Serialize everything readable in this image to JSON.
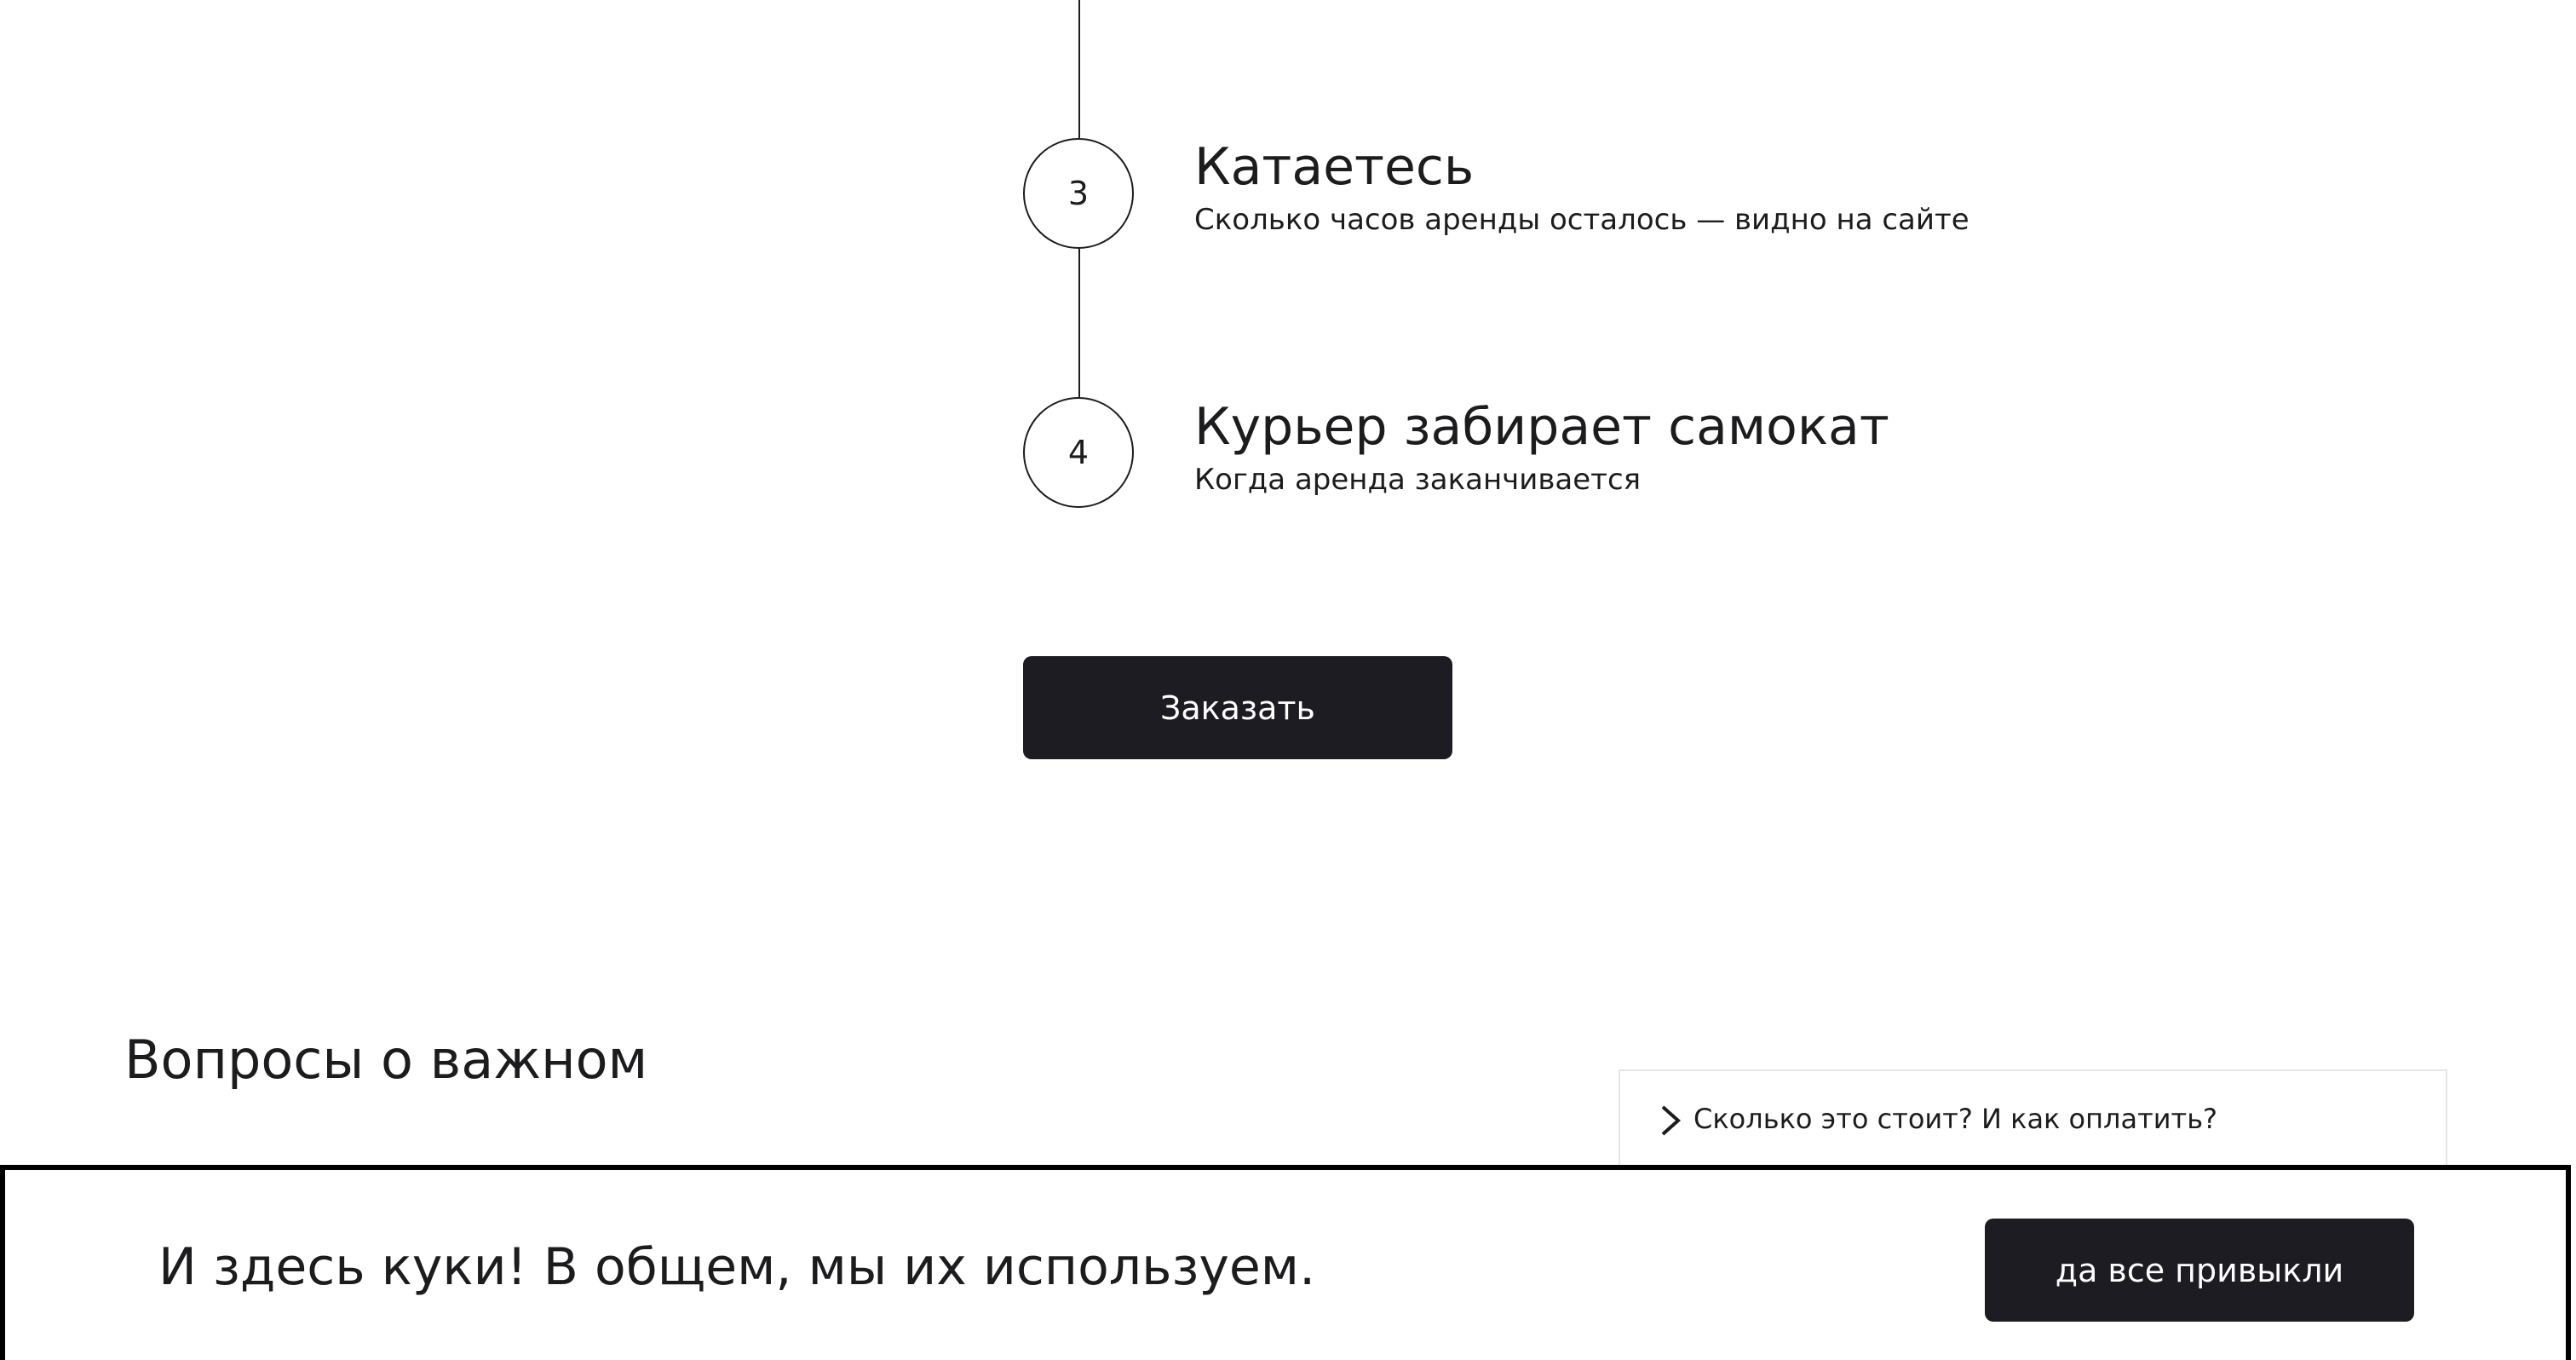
{
  "steps": [
    {
      "number": "3",
      "title": "Катаетесь",
      "description": "Сколько часов аренды осталось — видно на сайте"
    },
    {
      "number": "4",
      "title": "Курьер забирает самокат",
      "description": "Когда аренда заканчивается"
    }
  ],
  "order_button": {
    "label": "Заказать"
  },
  "faq": {
    "title": "Вопросы о важном",
    "items": [
      {
        "question": "Сколько это стоит? И как оплатить?",
        "icon": "chevron-right-icon"
      }
    ]
  },
  "cookie_banner": {
    "text": "И здесь куки! В общем, мы их используем.",
    "accept_label": "да все привыкли"
  },
  "colors": {
    "button_bg": "#1c1c22",
    "text": "#1c1c1f",
    "background": "#ffffff"
  }
}
